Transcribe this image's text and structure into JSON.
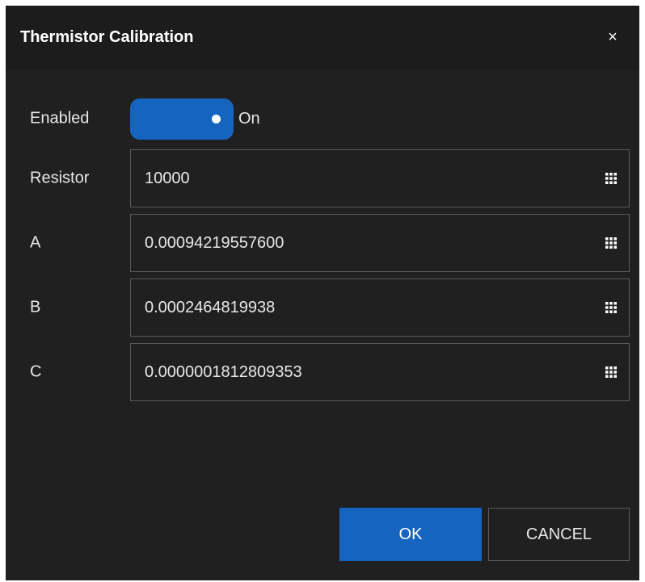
{
  "dialog": {
    "title": "Thermistor Calibration",
    "close_symbol": "×"
  },
  "enabled": {
    "label": "Enabled",
    "state": true,
    "state_text": "On"
  },
  "fields": [
    {
      "label": "Resistor",
      "value": "10000"
    },
    {
      "label": "A",
      "value": "0.00094219557600"
    },
    {
      "label": "B",
      "value": "0.0002464819938"
    },
    {
      "label": "C",
      "value": "0.0000001812809353"
    }
  ],
  "buttons": {
    "ok_label": "OK",
    "cancel_label": "CANCEL"
  },
  "icons": {
    "keypad": "keypad-icon",
    "close": "close-icon"
  },
  "colors": {
    "accent": "#1565c0",
    "background": "#202020",
    "titlebar": "#1c1c1c",
    "border": "#5a5a5a"
  }
}
